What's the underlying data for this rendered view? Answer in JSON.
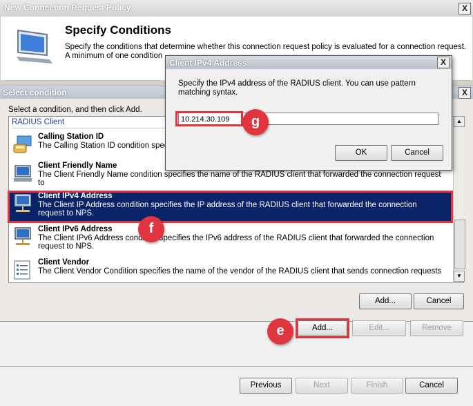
{
  "window": {
    "title": "New Connection Request Policy",
    "close_label": "X"
  },
  "header": {
    "title": "Specify Conditions",
    "description": "Specify the conditions that determine whether this connection request policy is evaluated for a connection request. A minimum of one condition"
  },
  "select_condition": {
    "title": "Select condition",
    "close_label": "X",
    "instruction": "Select a condition, and then click Add.",
    "group": "RADIUS Client",
    "items": [
      {
        "name": "Calling Station ID",
        "description": "The Calling Station ID condition speci",
        "icon": "phone-icon",
        "selected": false
      },
      {
        "name": "Client Friendly Name",
        "description": "The Client Friendly Name condition specifies the name of the RADIUS client that forwarded the connection request to",
        "icon": "computer-icon",
        "selected": false
      },
      {
        "name": "Client IPv4 Address",
        "description": "The Client IP Address condition specifies the IP address of the RADIUS client that forwarded the connection request to NPS.",
        "icon": "network-computer-icon",
        "selected": true
      },
      {
        "name": "Client IPv6 Address",
        "description": "The Client IPv6 Address condition specifies the IPv6 address of the RADIUS client that forwarded the connection request to NPS.",
        "icon": "network-computer-icon",
        "selected": false
      },
      {
        "name": "Client Vendor",
        "description": "The Client Vendor Condition specifies the name of the vendor of the RADIUS client that sends connection requests",
        "icon": "list-icon",
        "selected": false
      }
    ],
    "add_label": "Add...",
    "cancel_label": "Cancel"
  },
  "conditions_buttons": {
    "add": "Add...",
    "edit": "Edit...",
    "remove": "Remove"
  },
  "wizard_buttons": {
    "previous": "Previous",
    "next": "Next",
    "finish": "Finish",
    "cancel": "Cancel"
  },
  "ipv4_dialog": {
    "title": "Client IPv4 Address",
    "close_label": "X",
    "description": "Specify the IPv4 address of the RADIUS client. You can use pattern matching syntax.",
    "value": "10.214.30.109",
    "ok_label": "OK",
    "cancel_label": "Cancel"
  },
  "callouts": {
    "e": "e",
    "f": "f",
    "g": "g"
  },
  "colors": {
    "selection": "#0a246a",
    "callout": "#e0353f"
  }
}
